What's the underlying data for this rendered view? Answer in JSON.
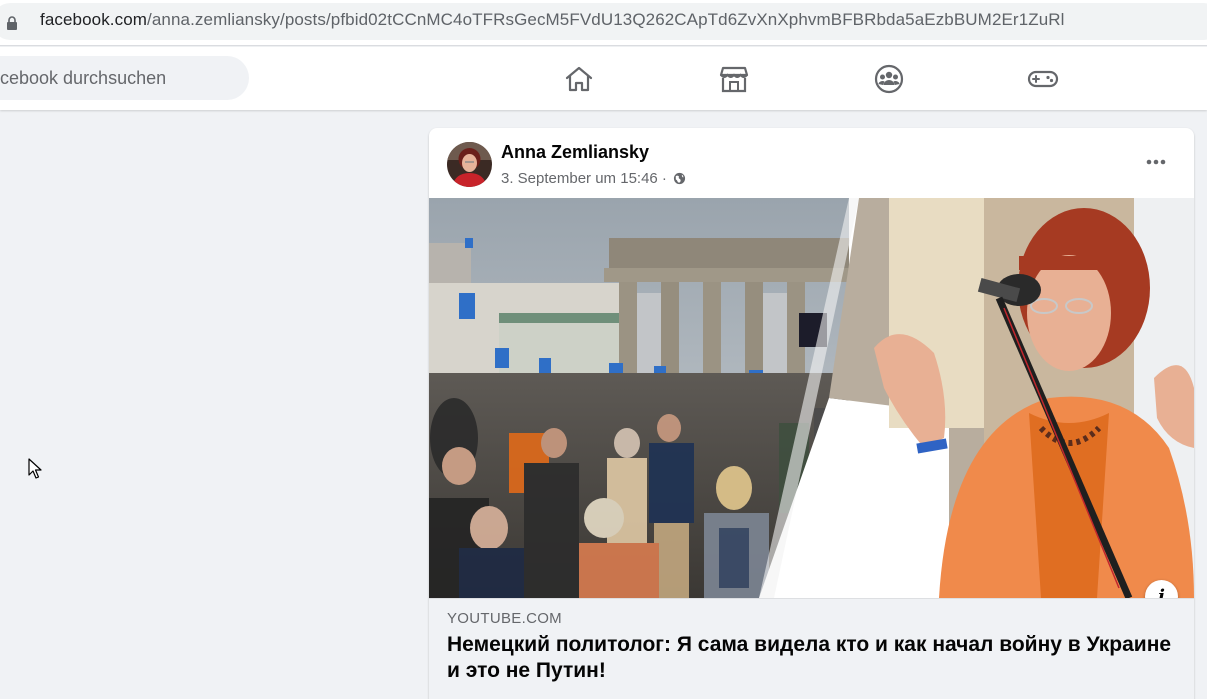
{
  "browser": {
    "url_host": "facebook.com",
    "url_path": "/anna.zemliansky/posts/pfbid02tCCnMC4oTFRsGecM5FVdU13Q262CApTd6ZvXnXphvmBFBRbda5aEzbBUM2Er1ZuRl"
  },
  "nav": {
    "search_placeholder": "Facebook durchsuchen",
    "search_visible_text": "cebook durchsuchen",
    "icons": [
      "home-icon",
      "marketplace-icon",
      "groups-icon",
      "gaming-icon"
    ]
  },
  "post": {
    "author": "Anna Zemliansky",
    "timestamp": "3. September um 15:46 ·",
    "privacy_icon": "globe-icon",
    "more_icon": "more-options-icon",
    "link": {
      "domain": "YOUTUBE.COM",
      "title": "Немецкий политолог: Я сама видела кто и как начал войну в Украине и это не Путин!"
    },
    "info_label": "i"
  },
  "colors": {
    "page_bg": "#f0f2f5",
    "card_bg": "#ffffff",
    "secondary_text": "#65676b",
    "primary_text": "#050505",
    "icon_color": "#65676b"
  }
}
